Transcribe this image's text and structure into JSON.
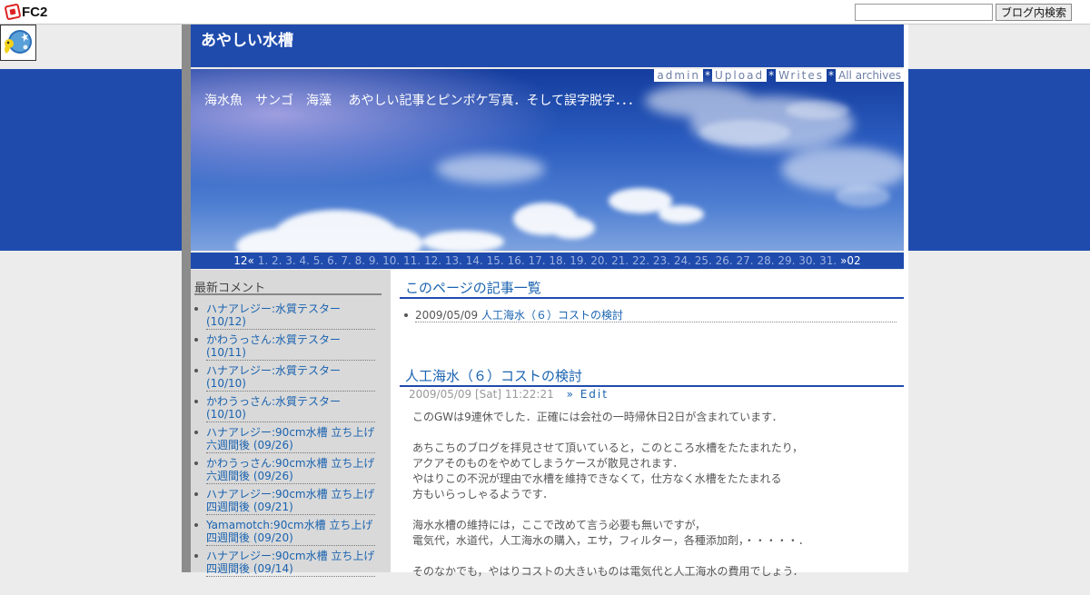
{
  "fc2": {
    "logo_text": "FC2",
    "search_placeholder": "",
    "search_button": "ブログ内検索"
  },
  "blog": {
    "title": "あやしい水槽",
    "subtitle": "海水魚　サンゴ　海藻　 あやしい記事とピンボケ写真．そして誤字脱字．．．",
    "admin_links": [
      "admin",
      "Upload",
      "Writes",
      "All archives"
    ],
    "admin_sep": "*"
  },
  "datenav": {
    "prev": "12«",
    "next": "»02",
    "days": [
      "1.",
      "2.",
      "3.",
      "4.",
      "5.",
      "6.",
      "7.",
      "8.",
      "9.",
      "10.",
      "11.",
      "12.",
      "13.",
      "14.",
      "15.",
      "16.",
      "17.",
      "18.",
      "19.",
      "20.",
      "21.",
      "22.",
      "23.",
      "24.",
      "25.",
      "26.",
      "27.",
      "28.",
      "29.",
      "30.",
      "31."
    ]
  },
  "sidebar": {
    "title": "最新コメント",
    "comments": [
      "ハナアレジー:水質テスター (10/12)",
      "かわうっさん:水質テスター (10/11)",
      "ハナアレジー:水質テスター (10/10)",
      "かわうっさん:水質テスター (10/10)",
      "ハナアレジー:90cm水槽 立ち上げ六週間後 (09/26)",
      "かわうっさん:90cm水槽 立ち上げ六週間後 (09/26)",
      "ハナアレジー:90cm水槽 立ち上げ四週間後 (09/21)",
      "Yamamotch:90cm水槽 立ち上げ四週間後 (09/20)",
      "ハナアレジー:90cm水槽 立ち上げ四週間後 (09/14)"
    ]
  },
  "main": {
    "list_title": "このページの記事一覧",
    "list_items": [
      {
        "date": "2009/05/09",
        "title": "人工海水（６）コストの検討"
      }
    ],
    "entry": {
      "title": "人工海水（６）コストの検討",
      "datetime": "2009/05/09 [Sat] 11:22:21",
      "edit_label": "» Edit",
      "paragraphs": [
        "このGWは9連休でした．正確には会社の一時帰休日2日が含まれています．",
        "あちこちのブログを拝見させて頂いていると，このところ水槽をたたまれたり，\nアクアそのものをやめてしまうケースが散見されます．\nやはりこの不況が理由で水槽を維持できなくて，仕方なく水槽をたたまれる\n方もいらっしゃるようです．",
        "海水水槽の維持には，ここで改めて言う必要も無いですが，\n電気代，水道代，人工海水の購入，エサ，フィルター，各種添加剤，・・・・・．",
        "そのなかでも，やはりコストの大きいものは電気代と人工海水の費用でしょう．"
      ]
    }
  },
  "colors": {
    "header_blue": "#1f4bad",
    "link_blue": "#1a63b0",
    "sidebar_bg": "#d9d9d9"
  }
}
